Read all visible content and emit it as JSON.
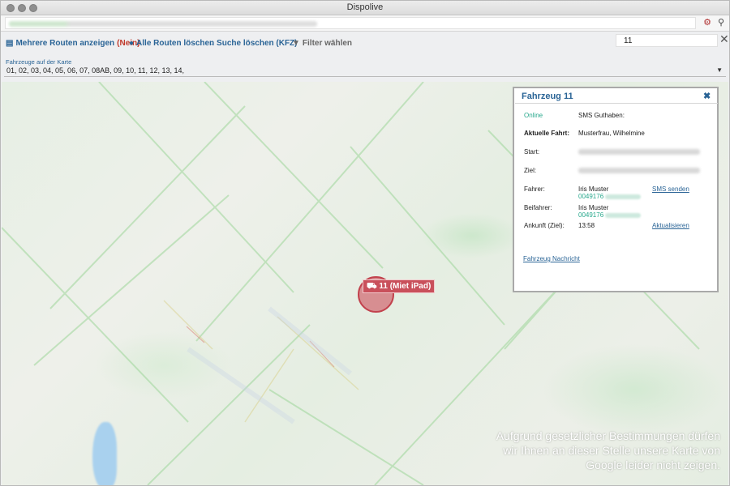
{
  "window": {
    "title": "Dispolive"
  },
  "toolbar": {
    "multi_routes_label": "Mehrere Routen anzeigen",
    "multi_routes_state": "(Nein)",
    "delete_routes_label": "Alle Routen löschen",
    "clear_search_label": "Suche löschen (KFZ)",
    "filter_label": "Filter wählen",
    "search_value": "11"
  },
  "vehicles": {
    "label": "Fahrzeuge auf der Karte",
    "selected": "01, 02, 03, 04, 05, 06, 07, 08AB, 09, 10, 11, 12, 13, 14,"
  },
  "marker": {
    "label": "11 (Miet iPad)"
  },
  "map": {
    "notice": "Aufgrund gesetzlicher Bestimmungen dürfen wir Ihnen an dieser Stelle unsere Karte von Google leider nicht zeigen."
  },
  "popup": {
    "title": "Fahrzeug 11",
    "status": "Online",
    "sms_credit_label": "SMS Guthaben:",
    "current_trip_label": "Aktuelle Fahrt:",
    "current_trip_value": "Musterfrau, Wilhelmine",
    "start_label": "Start:",
    "destination_label": "Ziel:",
    "driver_label": "Fahrer:",
    "driver_name": "Iris Muster",
    "driver_phone": "0049176",
    "send_sms_link": "SMS senden",
    "co_driver_label": "Beifahrer:",
    "co_driver_name": "Iris Muster",
    "co_driver_phone": "0049176",
    "arrival_label": "Ankunft (Ziel):",
    "arrival_time": "13:58",
    "refresh_link": "Aktualisieren",
    "vehicle_message_link": "Fahrzeug Nachricht"
  },
  "colors": {
    "link_blue": "#2a6496",
    "online_green": "#27a88c",
    "marker_red": "#c9505b"
  }
}
